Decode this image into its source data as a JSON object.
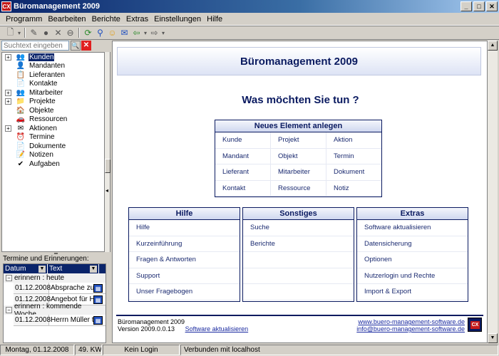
{
  "window": {
    "title": "Büromanagement 2009",
    "app_icon_text": "CX",
    "minimize": "_",
    "maximize": "□",
    "close": "✕"
  },
  "menu": [
    "Programm",
    "Bearbeiten",
    "Berichte",
    "Extras",
    "Einstellungen",
    "Hilfe"
  ],
  "search": {
    "placeholder": "Suchtext eingeben",
    "go": "🔍",
    "clear": "✕"
  },
  "tree": [
    {
      "label": "Kunden",
      "icon": "👥",
      "expandable": true,
      "selected": true
    },
    {
      "label": "Mandanten",
      "icon": "👤",
      "expandable": false
    },
    {
      "label": "Lieferanten",
      "icon": "📋",
      "expandable": false
    },
    {
      "label": "Kontakte",
      "icon": "📄",
      "expandable": false
    },
    {
      "label": "Mitarbeiter",
      "icon": "👥",
      "expandable": true
    },
    {
      "label": "Projekte",
      "icon": "📁",
      "expandable": true
    },
    {
      "label": "Objekte",
      "icon": "🏠",
      "expandable": false
    },
    {
      "label": "Ressourcen",
      "icon": "🚗",
      "expandable": false
    },
    {
      "label": "Aktionen",
      "icon": "✉",
      "expandable": true
    },
    {
      "label": "Termine",
      "icon": "⏰",
      "expandable": false
    },
    {
      "label": "Dokumente",
      "icon": "📄",
      "expandable": false
    },
    {
      "label": "Notizen",
      "icon": "📝",
      "expandable": false
    },
    {
      "label": "Aufgaben",
      "icon": "✔",
      "expandable": false
    }
  ],
  "reminders": {
    "label": "Termine und Erinnerungen:",
    "columns": [
      "Datum",
      "Text"
    ],
    "groups": [
      {
        "title": "erinnern : heute",
        "rows": [
          {
            "date": "01.12.2008",
            "text": "Absprache zum Pr"
          },
          {
            "date": "01.12.2008",
            "text": "Angebot für Herrn"
          }
        ]
      },
      {
        "title": "erinnern : kommende Woche",
        "rows": [
          {
            "date": "01.12.2008",
            "text": "Herrn Müller treffe"
          }
        ]
      }
    ]
  },
  "main": {
    "hero_title": "Büromanagement 2009",
    "question": "Was möchten Sie tun ?",
    "neu": {
      "title": "Neues Element anlegen",
      "rows": [
        [
          "Kunde",
          "Projekt",
          "Aktion"
        ],
        [
          "Mandant",
          "Objekt",
          "Termin"
        ],
        [
          "Lieferant",
          "Mitarbeiter",
          "Dokument"
        ],
        [
          "Kontakt",
          "Ressource",
          "Notiz"
        ]
      ]
    },
    "hilfe": {
      "title": "Hilfe",
      "items": [
        "Hilfe",
        "Kurzeinführung",
        "Fragen & Antworten",
        "Support",
        "Unser Fragebogen"
      ]
    },
    "sonstiges": {
      "title": "Sonstiges",
      "items": [
        "Suche",
        "Berichte",
        "",
        "",
        ""
      ]
    },
    "extras": {
      "title": "Extras",
      "items": [
        "Software aktualisieren",
        "Datensicherung",
        "Optionen",
        "Nutzerlogin und Rechte",
        "Import & Export"
      ]
    },
    "footer": {
      "product": "Büromanagement 2009",
      "version": "Version 2009.0.0.13",
      "update_link": "Software aktualisieren",
      "website": "www.buero-management-software.de",
      "email": "info@buero-management-software.de",
      "logo_text": "CX"
    }
  },
  "status": {
    "date": "Montag, 01.12.2008",
    "week": "49. KW",
    "login": "Kein Login",
    "connection": "Verbunden mit localhost"
  }
}
